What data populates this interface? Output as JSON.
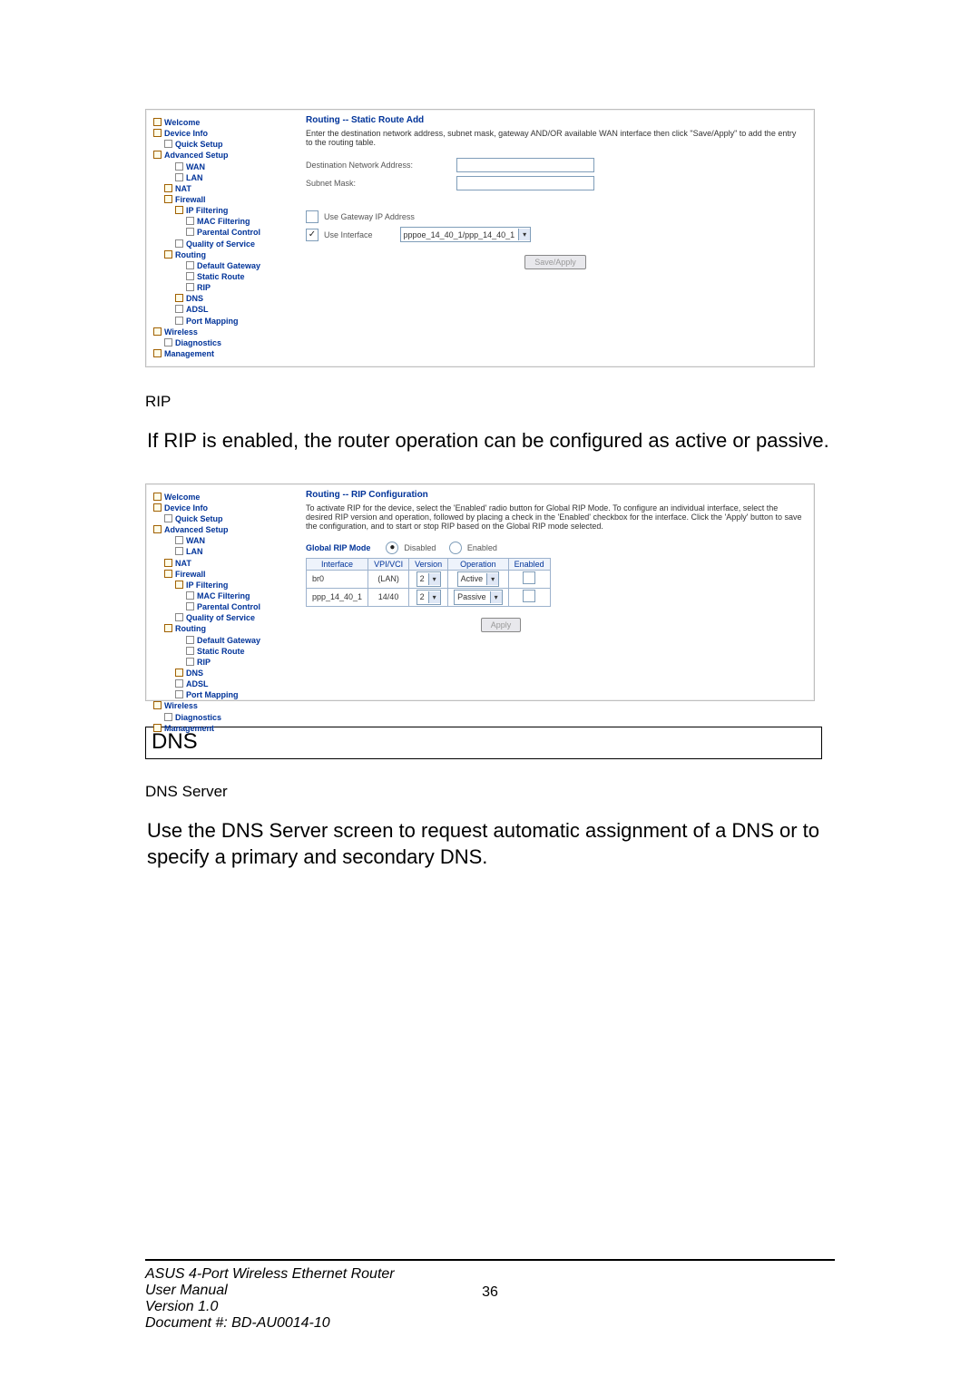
{
  "tree_common": {
    "welcome": "Welcome",
    "device_info": "Device Info",
    "quick_setup": "Quick Setup",
    "advanced_setup": "Advanced Setup",
    "wan": "WAN",
    "lan": "LAN",
    "nat": "NAT",
    "firewall": "Firewall",
    "ip_filtering": "IP Filtering",
    "mac_filtering": "MAC Filtering",
    "parental_control": "Parental Control",
    "qos": "Quality of Service",
    "routing": "Routing",
    "default_gateway": "Default Gateway",
    "static_route": "Static Route",
    "rip": "RIP",
    "dns": "DNS",
    "adsl": "ADSL",
    "port_mapping": "Port Mapping",
    "wireless": "Wireless",
    "diagnostics": "Diagnostics",
    "management": "Management"
  },
  "shot1": {
    "title": "Routing -- Static Route Add",
    "desc": "Enter the destination network address, subnet mask, gateway AND/OR available WAN interface then click \"Save/Apply\" to add the entry to the routing table.",
    "dest_label": "Destination Network Address:",
    "mask_label": "Subnet Mask:",
    "use_gateway_label": "Use Gateway IP Address",
    "use_interface_label": "Use Interface",
    "interface_value": "pppoe_14_40_1/ppp_14_40_1",
    "button": "Save/Apply"
  },
  "mid_heading": "RIP",
  "mid_text": "If RIP is enabled, the router operation can be configured as active or passive.",
  "shot2": {
    "title": "Routing -- RIP Configuration",
    "desc": "To activate RIP for the device, select the 'Enabled' radio button for Global RIP Mode. To configure an individual interface, select the desired RIP version and operation, followed by placing a check in the 'Enabled' checkbox for the interface. Click the 'Apply' button to save the configuration, and to start or stop RIP based on the Global RIP mode selected.",
    "global_label": "Global RIP Mode",
    "radio_disabled": "Disabled",
    "radio_enabled": "Enabled",
    "th_interface": "Interface",
    "th_vpivci": "VPI/VCI",
    "th_version": "Version",
    "th_operation": "Operation",
    "th_enabled": "Enabled",
    "row1_if": "br0",
    "row1_vc": "(LAN)",
    "row1_ver": "2",
    "row1_op": "Active",
    "row2_if": "ppp_14_40_1",
    "row2_vc": "14/40",
    "row2_ver": "2",
    "row2_op": "Passive",
    "button": "Apply"
  },
  "section_dns": "DNS",
  "dns_sub": "DNS Server",
  "dns_text": "Use the DNS Server screen to request automatic assignment of a DNS or to specify a primary and secondary DNS.",
  "footer": {
    "line1": "ASUS 4-Port Wireless Ethernet Router",
    "line2": "User Manual",
    "line3": "Version 1.0",
    "line4": "Document #:  BD-AU0014-10",
    "page": "36"
  }
}
